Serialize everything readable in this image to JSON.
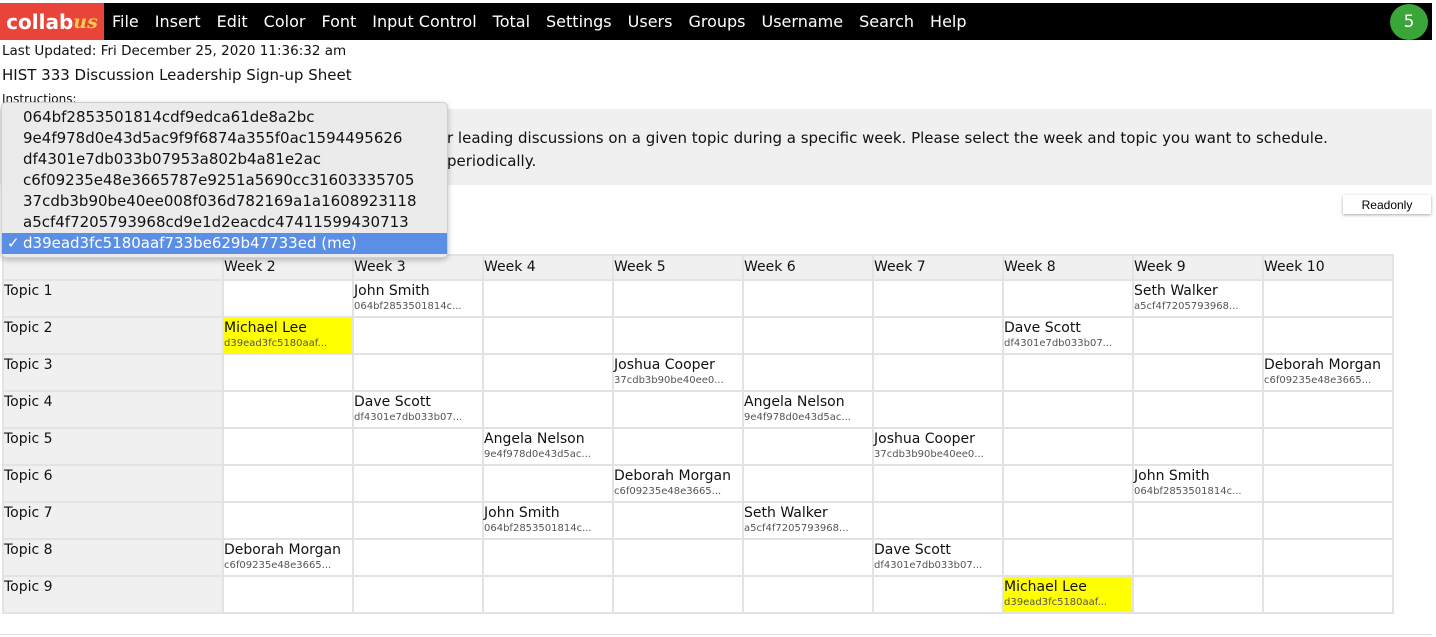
{
  "app": {
    "logo_main": "collab",
    "logo_accent": "us",
    "users_online": "5"
  },
  "menu": [
    "File",
    "Insert",
    "Edit",
    "Color",
    "Font",
    "Input Control",
    "Total",
    "Settings",
    "Users",
    "Groups",
    "Username",
    "Search",
    "Help"
  ],
  "last_updated": "Last Updated: Fri December 25, 2020 11:36:32 am",
  "title": "HIST 333 Discussion Leadership Sign-up Sheet",
  "instructions_label": "Instructions:",
  "instructions_line1": "r leading discussions on a given topic during a specific week. Please select the week and topic you want to schedule.",
  "instructions_line2": "periodically.",
  "readonly_label": "Readonly",
  "username_dropdown": {
    "options": [
      "064bf2853501814cdf9edca61de8a2bc",
      "9e4f978d0e43d5ac9f9f6874a355f0ac1594495626",
      "df4301e7db033b07953a802b4a81e2ac",
      "c6f09235e48e3665787e9251a5690cc31603335705",
      "37cdb3b90be40ee008f036d782169a1a1608923118",
      "a5cf4f7205793968cd9e1d2eacdc47411599430713",
      "d39ead3fc5180aaf733be629b47733ed (me)"
    ],
    "selected_index": 6,
    "check": "✓"
  },
  "highlight_color": "#ffff00",
  "table": {
    "columns": [
      "",
      "Week 2",
      "Week 3",
      "Week 4",
      "Week 5",
      "Week 6",
      "Week 7",
      "Week 8",
      "Week 9",
      "Week 10"
    ],
    "rows": [
      {
        "topic": "Topic 1",
        "cells": {
          "2": [
            "John Smith",
            "064bf2853501814c..."
          ],
          "8": [
            "Seth Walker",
            "a5cf4f7205793968..."
          ]
        }
      },
      {
        "topic": "Topic 2",
        "cells": {
          "1": [
            "Michael Lee",
            "d39ead3fc5180aaf...",
            true
          ],
          "7": [
            "Dave Scott",
            "df4301e7db033b07..."
          ]
        }
      },
      {
        "topic": "Topic 3",
        "cells": {
          "4": [
            "Joshua Cooper",
            "37cdb3b90be40ee0..."
          ],
          "9": [
            "Deborah Morgan",
            "c6f09235e48e3665..."
          ]
        }
      },
      {
        "topic": "Topic 4",
        "cells": {
          "2": [
            "Dave Scott",
            "df4301e7db033b07..."
          ],
          "5": [
            "Angela Nelson",
            "9e4f978d0e43d5ac..."
          ]
        }
      },
      {
        "topic": "Topic 5",
        "cells": {
          "3": [
            "Angela Nelson",
            "9e4f978d0e43d5ac..."
          ],
          "6": [
            "Joshua Cooper",
            "37cdb3b90be40ee0..."
          ]
        }
      },
      {
        "topic": "Topic 6",
        "cells": {
          "4": [
            "Deborah Morgan",
            "c6f09235e48e3665..."
          ],
          "8": [
            "John Smith",
            "064bf2853501814c..."
          ]
        }
      },
      {
        "topic": "Topic 7",
        "cells": {
          "3": [
            "John Smith",
            "064bf2853501814c..."
          ],
          "5": [
            "Seth Walker",
            "a5cf4f7205793968..."
          ]
        }
      },
      {
        "topic": "Topic 8",
        "cells": {
          "1": [
            "Deborah Morgan",
            "c6f09235e48e3665..."
          ],
          "6": [
            "Dave Scott",
            "df4301e7db033b07..."
          ]
        }
      },
      {
        "topic": "Topic 9",
        "cells": {
          "7": [
            "Michael Lee",
            "d39ead3fc5180aaf...",
            true
          ]
        }
      }
    ]
  }
}
